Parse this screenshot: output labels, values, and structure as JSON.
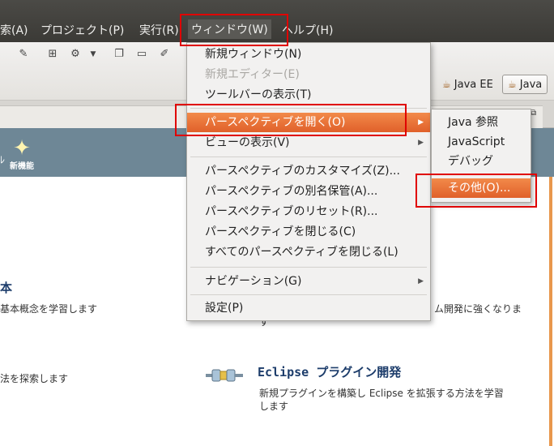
{
  "menubar": {
    "items": [
      "索(A)",
      "プロジェクト(P)",
      "実行(R)",
      "ウィンドウ(W)",
      "ヘルプ(H)"
    ]
  },
  "toolbar": {
    "icons": [
      "pin-icon",
      "grid-icon",
      "gear-run-icon",
      "dropdown-icon",
      "folder-open-icon",
      "folder-icon",
      "brush-icon"
    ]
  },
  "perspectives": {
    "java_ee": "Java EE",
    "java": "Java"
  },
  "welcome": {
    "new_features": "新機能",
    "left_title_fragment": "本",
    "left_desc_1": "基本概念を学習します",
    "left_desc_2": "法を探索します",
    "right_desc_fragment_1": "ム開発に強くなりま",
    "right_desc_fragment_2": "す",
    "plugin_title": "Eclipse プラグイン開発",
    "plugin_desc_1": "新規プラグインを構築し Eclipse を拡張する方法を学習",
    "plugin_desc_2": "します"
  },
  "window_menu": {
    "new_window": "新規ウィンドウ(N)",
    "new_editor": "新規エディター(E)",
    "show_toolbar": "ツールバーの表示(T)",
    "open_perspective": "パースペクティブを開く(O)",
    "show_view": "ビューの表示(V)",
    "customize_perspective": "パースペクティブのカスタマイズ(Z)...",
    "save_perspective_as": "パースペクティブの別名保管(A)...",
    "reset_perspective": "パースペクティブのリセット(R)...",
    "close_perspective": "パースペクティブを閉じる(C)",
    "close_all_perspectives": "すべてのパースペクティブを閉じる(L)",
    "navigation": "ナビゲーション(G)",
    "preferences": "設定(P)"
  },
  "perspective_submenu": {
    "java_browsing": "Java 参照",
    "javascript": "JavaScript",
    "debug": "デバッグ",
    "other": "その他(O)..."
  },
  "colors": {
    "highlight": "#e96f35",
    "annotation": "#e00000",
    "menubar": "#3c3b37",
    "welcome_header": "#6e8796"
  }
}
